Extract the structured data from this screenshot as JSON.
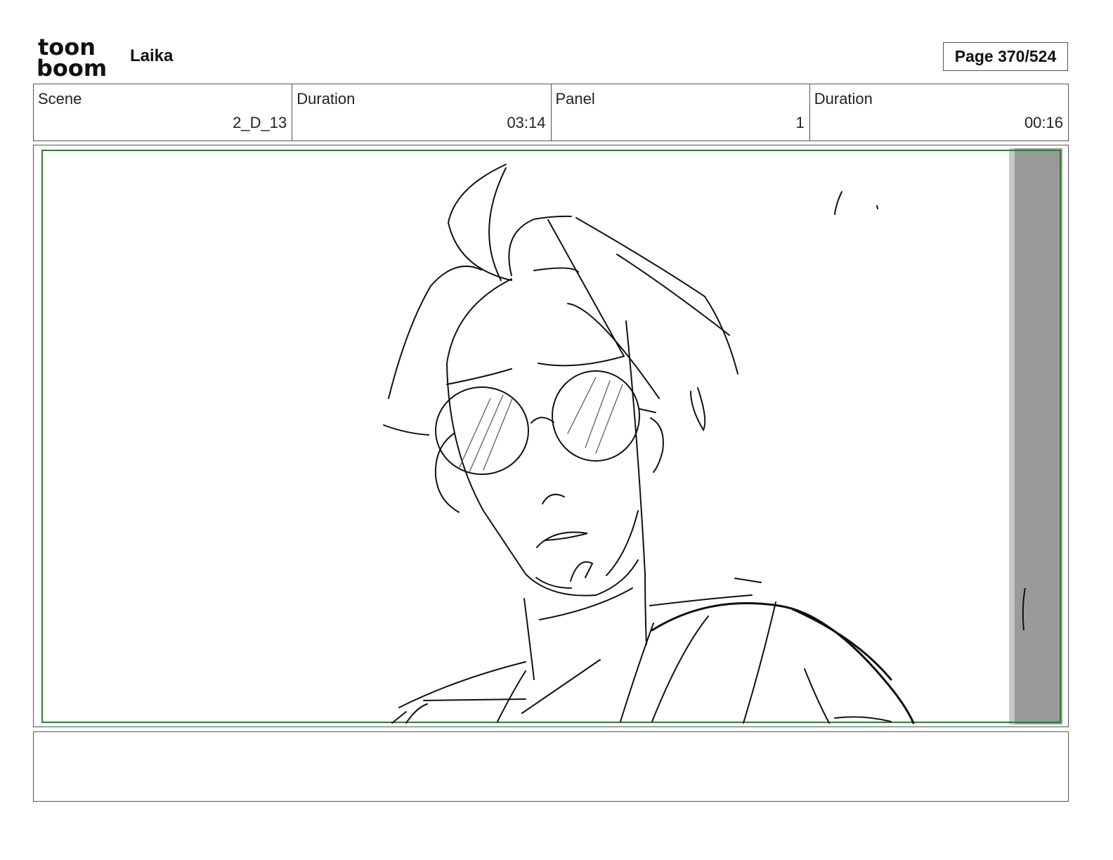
{
  "header": {
    "logo_line1": "toon",
    "logo_line2": "boom",
    "project": "Laika",
    "page_label": "Page 370/524"
  },
  "info": [
    {
      "label": "Scene",
      "value": "2_D_13"
    },
    {
      "label": "Duration",
      "value": "03:14"
    },
    {
      "label": "Panel",
      "value": "1"
    },
    {
      "label": "Duration",
      "value": "00:16"
    }
  ],
  "panel": {
    "safe_frame_color": "#2e7d32",
    "edge_strip_color": "#9a9a9a",
    "subject": "sketch-character-with-round-glasses"
  },
  "notes": {
    "text": ""
  }
}
